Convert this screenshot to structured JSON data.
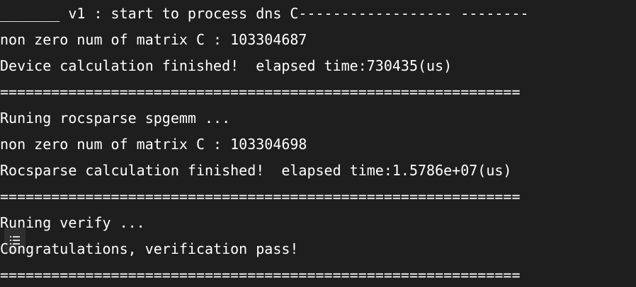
{
  "terminal": {
    "lines": [
      "_______ v1 : start to process dns C------------------ --------",
      "non zero num of matrix C : 103304687",
      "Device calculation finished!  elapsed time:730435(us)",
      "=============================================================",
      "Runing rocsparse spgemm ...",
      "non zero num of matrix C : 103304698",
      "Rocsparse calculation finished!  elapsed time:1.5786e+07(us)",
      "=============================================================",
      "Runing verify ...",
      "Congratulations, verification pass!",
      "============================================================="
    ]
  },
  "icons": {
    "menu": "list-menu-icon"
  },
  "colors": {
    "background": "#1e1e1e",
    "text": "#ffffff"
  }
}
